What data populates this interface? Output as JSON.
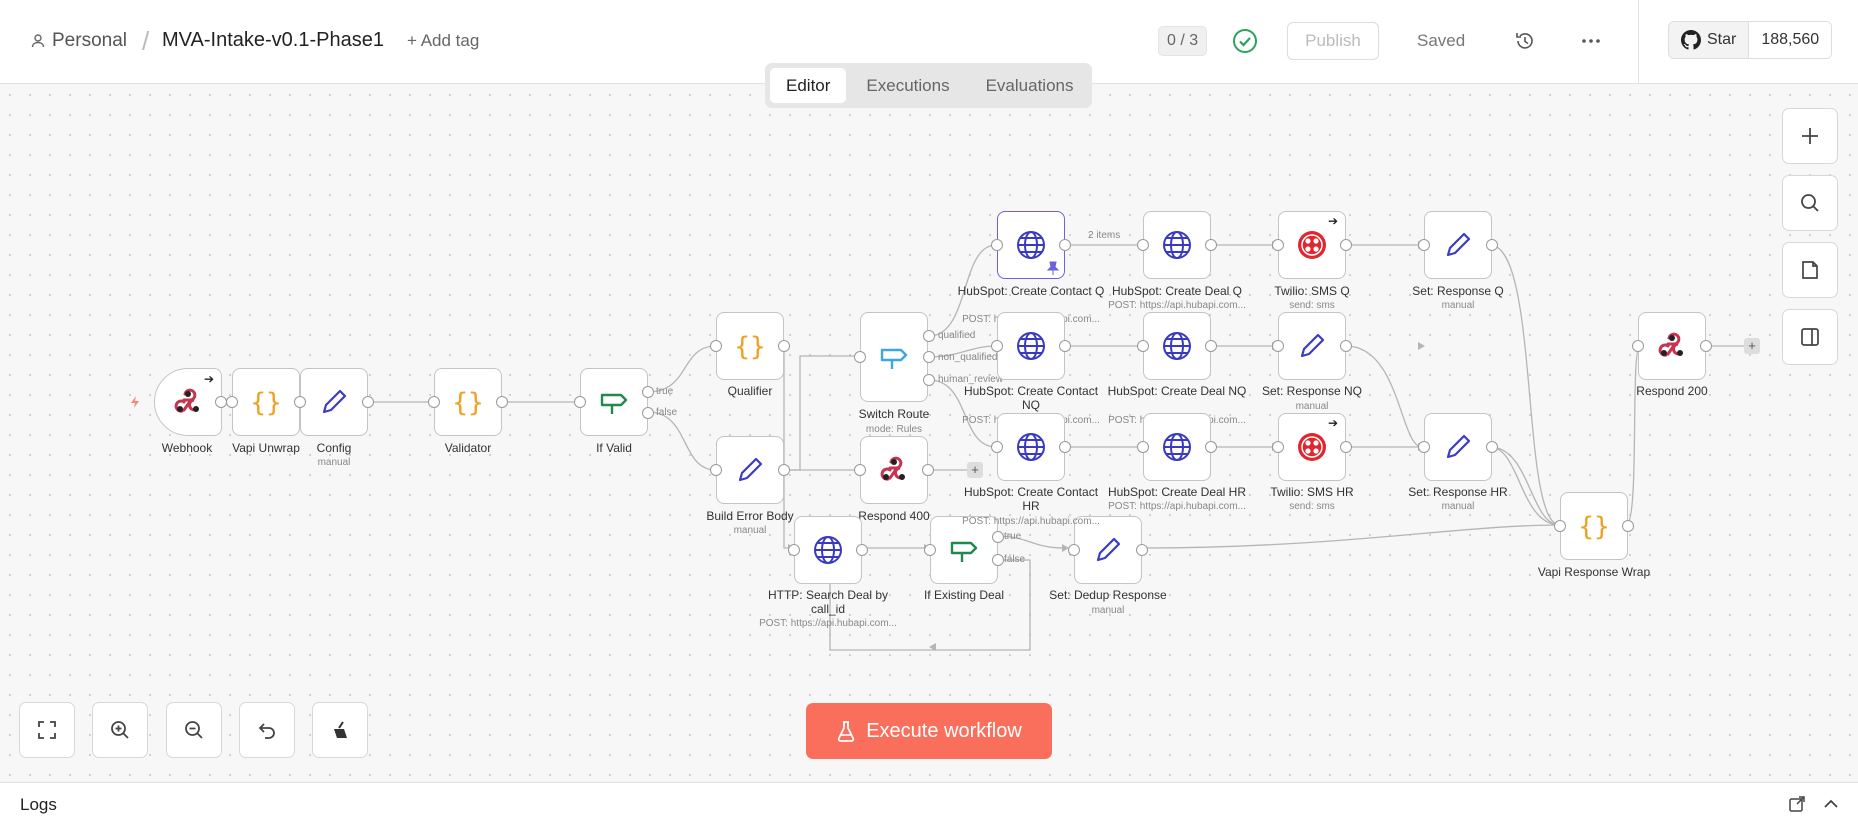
{
  "header": {
    "user": "Personal",
    "separator": "/",
    "workflow_name": "MVA-Intake-v0.1-Phase1",
    "add_tag": "+ Add tag",
    "counter": "0 / 3",
    "publish": "Publish",
    "saved": "Saved",
    "github": {
      "star": "Star",
      "count": "188,560"
    }
  },
  "tabs": [
    "Editor",
    "Executions",
    "Evaluations"
  ],
  "nodes": {
    "webhook": {
      "label": "Webhook"
    },
    "vapi_unwrap": {
      "label": "Vapi Unwrap"
    },
    "config": {
      "label": "Config",
      "sub": "manual"
    },
    "validator": {
      "label": "Validator"
    },
    "if_valid": {
      "label": "If Valid"
    },
    "qualifier": {
      "label": "Qualifier"
    },
    "build_error": {
      "label": "Build Error Body",
      "sub": "manual"
    },
    "switch_route": {
      "label": "Switch Route",
      "sub": "mode: Rules"
    },
    "respond_400": {
      "label": "Respond 400"
    },
    "http_search": {
      "label": "HTTP: Search Deal by call_id",
      "sub": "POST: https://api.hubapi.com..."
    },
    "if_existing": {
      "label": "If Existing Deal"
    },
    "set_dedup": {
      "label": "Set: Dedup Response",
      "sub": "manual"
    },
    "hs_contact_q": {
      "label": "HubSpot: Create Contact Q",
      "sub": "POST: https://api.hubapi.com..."
    },
    "hs_contact_nq": {
      "label": "HubSpot: Create Contact NQ",
      "sub": "POST: https://api.hubapi.com..."
    },
    "hs_contact_hr": {
      "label": "HubSpot: Create Contact HR",
      "sub": "POST: https://api.hubapi.com..."
    },
    "hs_deal_q": {
      "label": "HubSpot: Create Deal Q",
      "sub": "POST: https://api.hubapi.com..."
    },
    "hs_deal_nq": {
      "label": "HubSpot: Create Deal NQ",
      "sub": "POST: https://api.hubapi.com..."
    },
    "hs_deal_hr": {
      "label": "HubSpot: Create Deal HR",
      "sub": "POST: https://api.hubapi.com..."
    },
    "twilio_q": {
      "label": "Twilio: SMS Q",
      "sub": "send: sms"
    },
    "set_resp_nq": {
      "label": "Set: Response NQ",
      "sub": "manual"
    },
    "twilio_hr": {
      "label": "Twilio: SMS HR",
      "sub": "send: sms"
    },
    "set_resp_q": {
      "label": "Set: Response Q",
      "sub": "manual"
    },
    "set_resp_hr": {
      "label": "Set: Response HR",
      "sub": "manual"
    },
    "vapi_wrap": {
      "label": "Vapi Response Wrap"
    },
    "respond_200": {
      "label": "Respond 200"
    }
  },
  "edge_labels": {
    "true": "true",
    "false": "false",
    "qualified": "qualified",
    "non_qualified": "non_qualified",
    "human_review": "human_review",
    "items": "2 items",
    "dedup_true": "true",
    "dedup_false": "false"
  },
  "execute_button": "Execute workflow",
  "logs": {
    "title": "Logs"
  },
  "colors": {
    "accent": "#fa6f5c",
    "selected": "#6b63d6",
    "code": "#f0a020",
    "set": "#3b3bc7",
    "http": "#3a3ac0",
    "if": "#1f8a4c",
    "twilio": "#e0262e",
    "webhook": "#c83350"
  }
}
